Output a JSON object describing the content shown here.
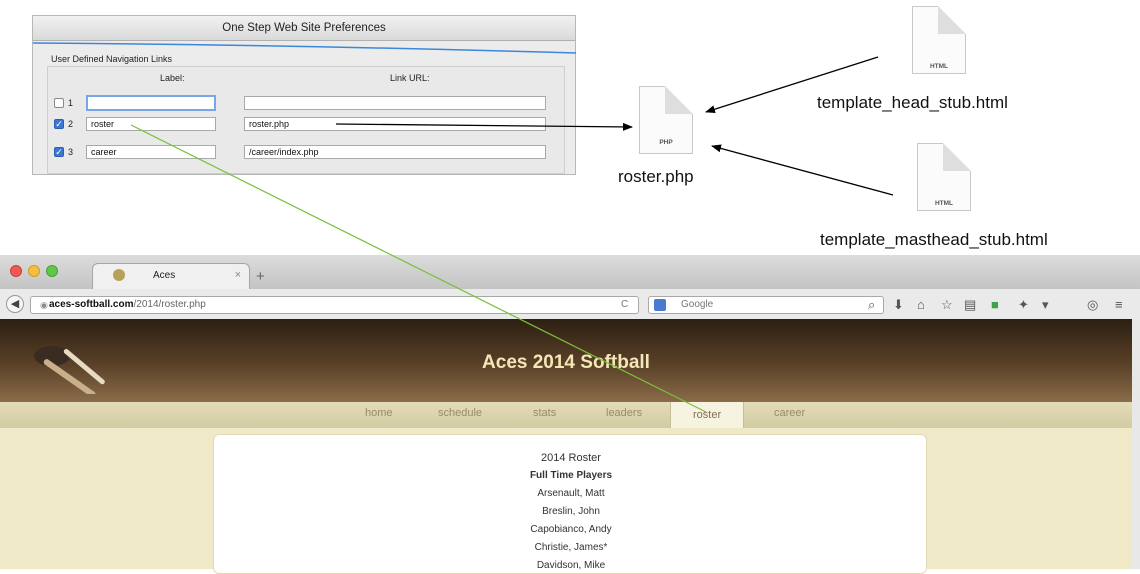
{
  "prefs_dialog": {
    "title": "One Step Web Site Preferences",
    "group_title": "User Defined Navigation Links",
    "col_label": "Label:",
    "col_url": "Link URL:",
    "rows": [
      {
        "num": "1",
        "checked": false,
        "label": "",
        "url": ""
      },
      {
        "num": "2",
        "checked": true,
        "label": "roster",
        "url": "roster.php"
      },
      {
        "num": "3",
        "checked": true,
        "label": "career",
        "url": "/career/index.php"
      }
    ]
  },
  "files": {
    "php_tag": "PHP",
    "php_name": "roster.php",
    "head_tag": "HTML",
    "head_name": "template_head_stub.html",
    "masthead_tag": "HTML",
    "masthead_name": "template_masthead_stub.html"
  },
  "browser": {
    "tab_title": "Aces",
    "tab_close": "×",
    "new_tab": "+",
    "url_domain": "aces-softball.com",
    "url_path": "/2014/roster.php",
    "search_placeholder": "Google",
    "reload": "C",
    "icons": [
      "back-icon",
      "site-identity-icon",
      "search-engine-icon",
      "download-icon",
      "home-icon",
      "bookmark-star-icon",
      "bookmarks-icon",
      "extension-icon",
      "share-icon",
      "menu-icon"
    ]
  },
  "site": {
    "title": "Aces 2014 Softball",
    "nav": [
      "home",
      "schedule",
      "stats",
      "leaders",
      "roster",
      "career"
    ],
    "active_nav": "roster",
    "roster_title": "2014 Roster",
    "roster_subtitle": "Full Time Players",
    "players": [
      "Arsenault, Matt",
      "Breslin, John",
      "Capobianco, Andy",
      "Christie, James*",
      "Davidson, Mike"
    ]
  },
  "colors": {
    "arrow": "#000000",
    "link_line": "#7cbf3a",
    "checkbox_on": "#3b78d6",
    "masthead_text": "#f3e7b8"
  }
}
